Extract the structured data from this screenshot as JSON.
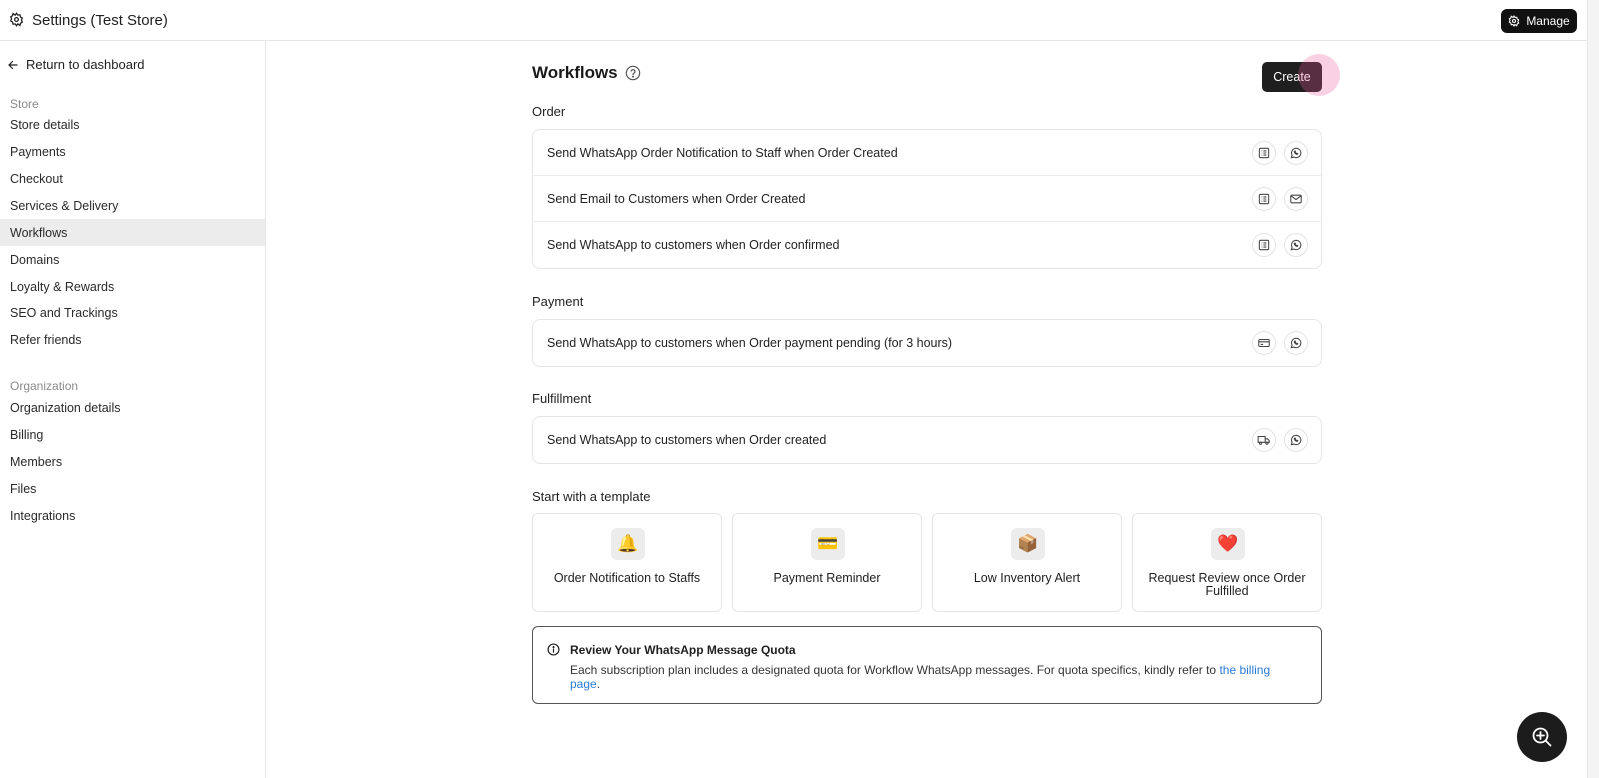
{
  "topbar": {
    "title": "Settings (Test Store)",
    "manage_label": "Manage"
  },
  "sidebar": {
    "back_label": "Return to dashboard",
    "store_label": "Store",
    "store_items": [
      {
        "label": "Store details"
      },
      {
        "label": "Payments"
      },
      {
        "label": "Checkout"
      },
      {
        "label": "Services & Delivery"
      },
      {
        "label": "Workflows"
      },
      {
        "label": "Domains"
      },
      {
        "label": "Loyalty & Rewards"
      },
      {
        "label": "SEO and Trackings"
      },
      {
        "label": "Refer friends"
      }
    ],
    "org_label": "Organization",
    "org_items": [
      {
        "label": "Organization details"
      },
      {
        "label": "Billing"
      },
      {
        "label": "Members"
      },
      {
        "label": "Files"
      },
      {
        "label": "Integrations"
      }
    ],
    "active_item": "Workflows"
  },
  "main": {
    "title": "Workflows",
    "create_label": "Create",
    "groups": [
      {
        "title": "Order",
        "rows": [
          {
            "label": "Send WhatsApp Order Notification to Staff when Order Created",
            "icons": [
              "list-icon",
              "whatsapp-icon"
            ]
          },
          {
            "label": "Send Email to Customers when Order Created",
            "icons": [
              "list-icon",
              "mail-icon"
            ]
          },
          {
            "label": "Send WhatsApp to customers when Order confirmed",
            "icons": [
              "list-icon",
              "whatsapp-icon"
            ]
          }
        ]
      },
      {
        "title": "Payment",
        "rows": [
          {
            "label": "Send WhatsApp to customers when Order payment pending (for 3 hours)",
            "icons": [
              "credit-card-icon",
              "whatsapp-icon"
            ]
          }
        ]
      },
      {
        "title": "Fulfillment",
        "rows": [
          {
            "label": "Send WhatsApp to customers when Order created",
            "icons": [
              "truck-icon",
              "whatsapp-icon"
            ]
          }
        ]
      }
    ],
    "templates_title": "Start with a template",
    "templates": [
      {
        "label": "Order Notification to Staffs",
        "emoji": "🔔"
      },
      {
        "label": "Payment Reminder",
        "emoji": "💳"
      },
      {
        "label": "Low Inventory Alert",
        "emoji": "📦"
      },
      {
        "label": "Request Review once Order Fulfilled",
        "emoji": "❤️"
      }
    ],
    "quota": {
      "title": "Review Your WhatsApp Message Quota",
      "text": "Each subscription plan includes a designated quota for Workflow WhatsApp messages. For quota specifics, kindly refer to ",
      "link": "the billing page",
      "suffix": "."
    }
  },
  "colors": {
    "accent_dark": "#1f1f1f",
    "link": "#2a7bd6",
    "active_nav": "#ececec"
  }
}
